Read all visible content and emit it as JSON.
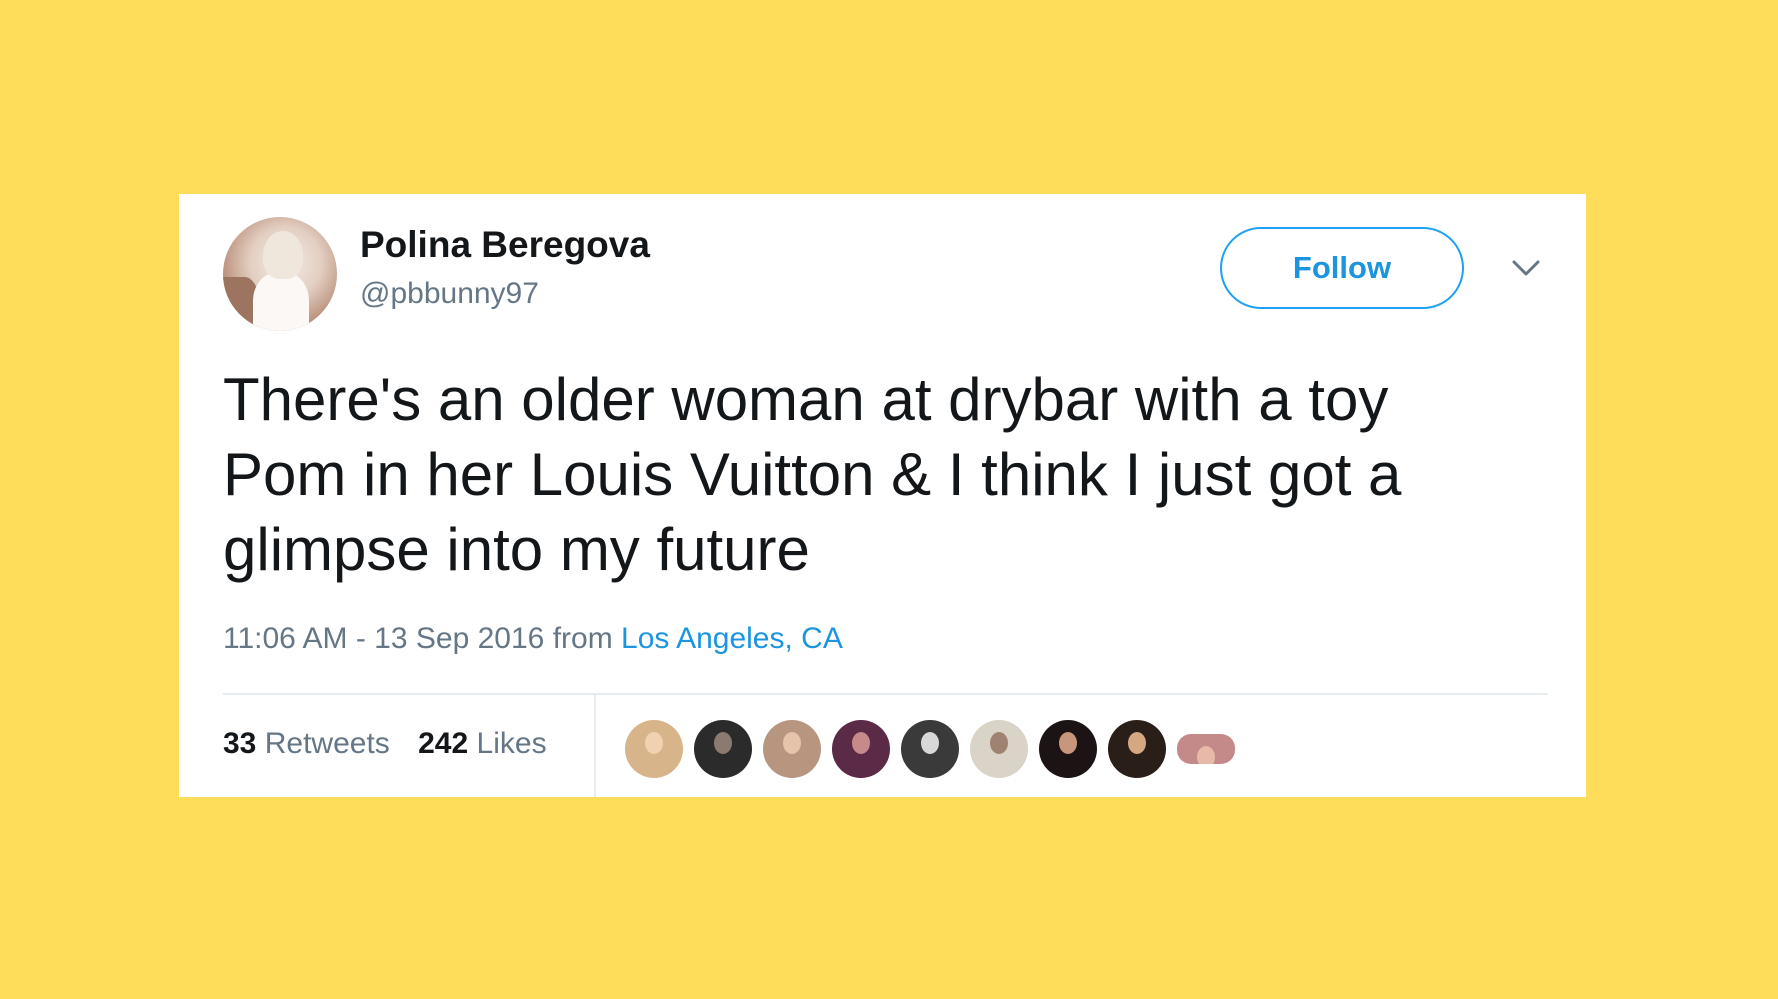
{
  "user": {
    "name": "Polina Beregova",
    "handle": "@pbbunny97"
  },
  "follow_label": "Follow",
  "tweet": {
    "text": "There's an older woman at drybar with a toy\nPom in her Louis Vuitton & I think I just got a\nglimpse into my future"
  },
  "meta": {
    "time_date": "11:06 AM - 13 Sep 2016",
    "from_word": "from",
    "location": "Los Angeles, CA"
  },
  "stats": {
    "retweets_count": "33",
    "retweets_label": "Retweets",
    "likes_count": "242",
    "likes_label": "Likes"
  },
  "likers": [
    {
      "name": "liker-avatar-1",
      "bg": "#d8b48a",
      "face": "#f0d2b0"
    },
    {
      "name": "liker-avatar-2",
      "bg": "#2b2b2b",
      "face": "#8a7a70"
    },
    {
      "name": "liker-avatar-3",
      "bg": "#b8957e",
      "face": "#e6c4ac"
    },
    {
      "name": "liker-avatar-4",
      "bg": "#5a2a46",
      "face": "#c78a8a"
    },
    {
      "name": "liker-avatar-5",
      "bg": "#3a3a3a",
      "face": "#d8d8d8"
    },
    {
      "name": "liker-avatar-6",
      "bg": "#d9d3c8",
      "face": "#a08270"
    },
    {
      "name": "liker-avatar-7",
      "bg": "#1c1414",
      "face": "#c8967a"
    },
    {
      "name": "liker-avatar-8",
      "bg": "#2a1e18",
      "face": "#d4a882"
    },
    {
      "name": "liker-avatar-9",
      "bg": "#c48a8a",
      "face": "#e8b8a8"
    }
  ],
  "colors": {
    "background": "#fedd5a",
    "link_blue": "#1b95e0",
    "text_dark": "#14171a",
    "text_gray": "#657786"
  },
  "icons": {
    "chevron": "chevron-down-icon"
  }
}
